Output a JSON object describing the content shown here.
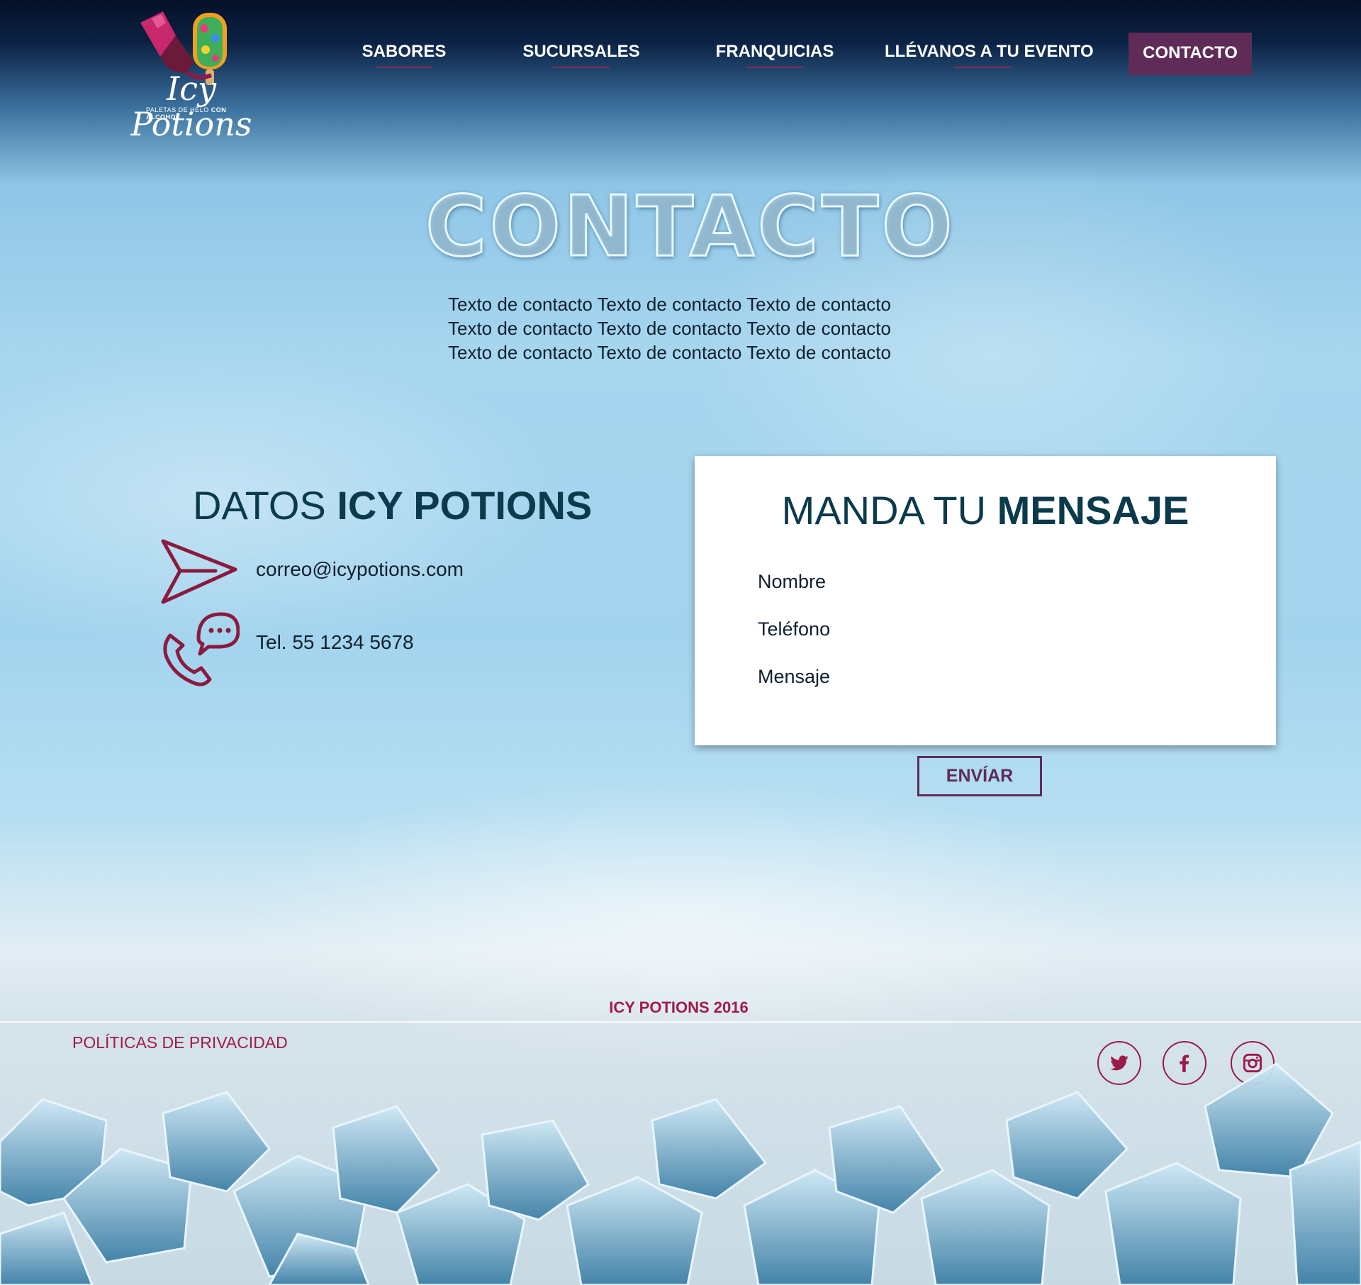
{
  "brand": {
    "name": "Icy Potions",
    "tagline_prefix": "PALETAS DE HELO",
    "tagline_suffix": "CON ALCOHOL",
    "primary_color": "#5f2c58",
    "accent_color": "#a01b4a",
    "heading_color": "#0b3a4c"
  },
  "nav": {
    "items": [
      {
        "label": "SABORES"
      },
      {
        "label": "SUCURSALES"
      },
      {
        "label": "FRANQUICIAS"
      },
      {
        "label": "LLÉVANOS A TU EVENTO"
      }
    ],
    "cta_label": "CONTACTO"
  },
  "hero": {
    "title": "CONTACTO",
    "intro": "Texto de contacto Texto de contacto Texto de contacto Texto de contacto Texto de contacto Texto de contacto Texto de contacto Texto de contacto Texto de contacto"
  },
  "datos": {
    "title_light": "DATOS ",
    "title_bold": "ICY POTIONS",
    "email": "correo@icypotions.com",
    "email_icon": "paper-plane-icon",
    "phone": "Tel. 55 1234 5678",
    "phone_icon": "phone-chat-icon"
  },
  "form": {
    "title_light": "MANDA TU ",
    "title_bold": "MENSAJE",
    "fields": [
      {
        "label": "Nombre",
        "value": ""
      },
      {
        "label": "Teléfono",
        "value": ""
      },
      {
        "label": "Mensaje",
        "value": ""
      }
    ],
    "submit_label": "ENVÍAR"
  },
  "footer": {
    "copyright": "ICY POTIONS 2016",
    "privacy_label": "POLÍTICAS DE PRIVACIDAD",
    "social": [
      "twitter-icon",
      "facebook-icon",
      "instagram-icon"
    ]
  }
}
